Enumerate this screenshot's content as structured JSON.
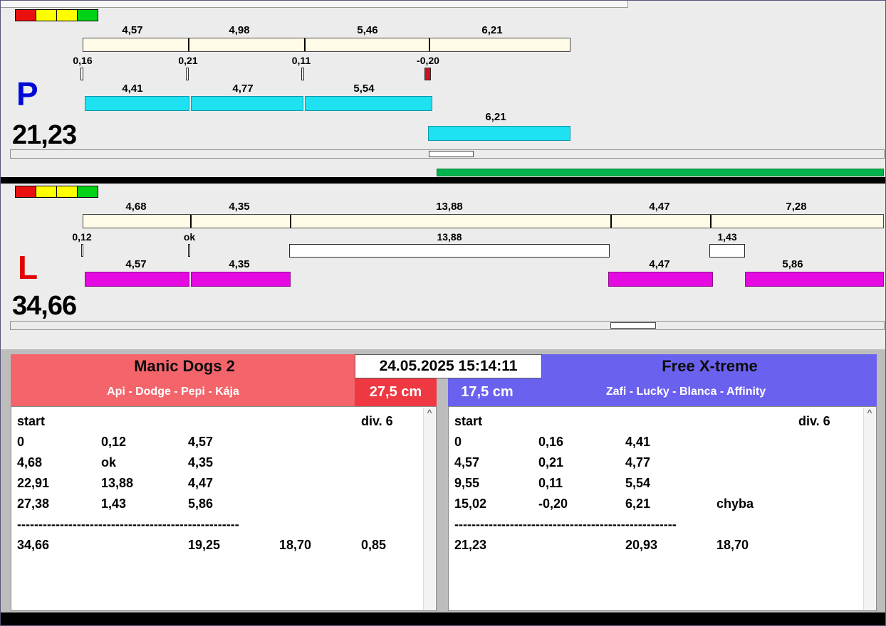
{
  "colors": {
    "background": "#ececec",
    "split_bar": "#fffbe6",
    "lane_p_bar": "#1ee2f2",
    "lane_l_bar": "#e50ae2",
    "progress_green": "#00b34d",
    "fault_tick_red": "#cf1020",
    "left_team_header": "#f4646b",
    "left_team_accent": "#ee3942",
    "right_team_header": "#6a62ee",
    "lane_p_letter": "#0009d6",
    "lane_l_letter": "#e20202",
    "light_red": "#ea1010",
    "light_yellow": "#ffff00",
    "light_green": "#00d218"
  },
  "icons": {
    "scroll_up": "^"
  },
  "timestamp": "24.05.2025 15:14:11",
  "lane_p": {
    "letter": "P",
    "total": "21,23",
    "splits": [
      "4,57",
      "4,98",
      "5,46",
      "6,21"
    ],
    "deltas": [
      "0,16",
      "0,21",
      "0,11",
      "-0,20"
    ],
    "runs": [
      "4,41",
      "4,77",
      "5,54"
    ],
    "extra_run": "6,21"
  },
  "lane_l": {
    "letter": "L",
    "total": "34,66",
    "splits": [
      "4,68",
      "4,35",
      "13,88",
      "4,47",
      "7,28"
    ],
    "deltas": [
      "0,12",
      "ok",
      "13,88",
      "1,43"
    ],
    "runs": [
      "4,57",
      "4,35",
      "4,47",
      "5,86"
    ]
  },
  "left_team": {
    "name": "Manic Dogs 2",
    "dogs": "Api - Dodge - Pepi - Kája",
    "jump_height": "27,5 cm",
    "table": {
      "col_start": "start",
      "col_div": "div.  6",
      "rows": [
        [
          "0",
          "0,12",
          "4,57",
          ""
        ],
        [
          "4,68",
          "ok",
          "4,35",
          ""
        ],
        [
          "22,91",
          "13,88",
          "4,47",
          ""
        ],
        [
          "27,38",
          "1,43",
          "5,86",
          ""
        ]
      ],
      "separator": "----------------------------------------------------",
      "total_time": "34,66",
      "sum1": "19,25",
      "sum2": "18,70",
      "sum3": "0,85"
    }
  },
  "right_team": {
    "name": "Free X-treme",
    "dogs": "Zafi - Lucky - Blanca - Affinity",
    "jump_height": "17,5 cm",
    "table": {
      "col_start": "start",
      "col_div": "div.  6",
      "rows": [
        [
          "0",
          "0,16",
          "4,41",
          ""
        ],
        [
          "4,57",
          "0,21",
          "4,77",
          ""
        ],
        [
          "9,55",
          "0,11",
          "5,54",
          ""
        ],
        [
          "15,02",
          "-0,20",
          "6,21",
          "chyba"
        ]
      ],
      "separator": "----------------------------------------------------",
      "total_time": "21,23",
      "sum1": "20,93",
      "sum2": "18,70",
      "sum3": ""
    }
  }
}
